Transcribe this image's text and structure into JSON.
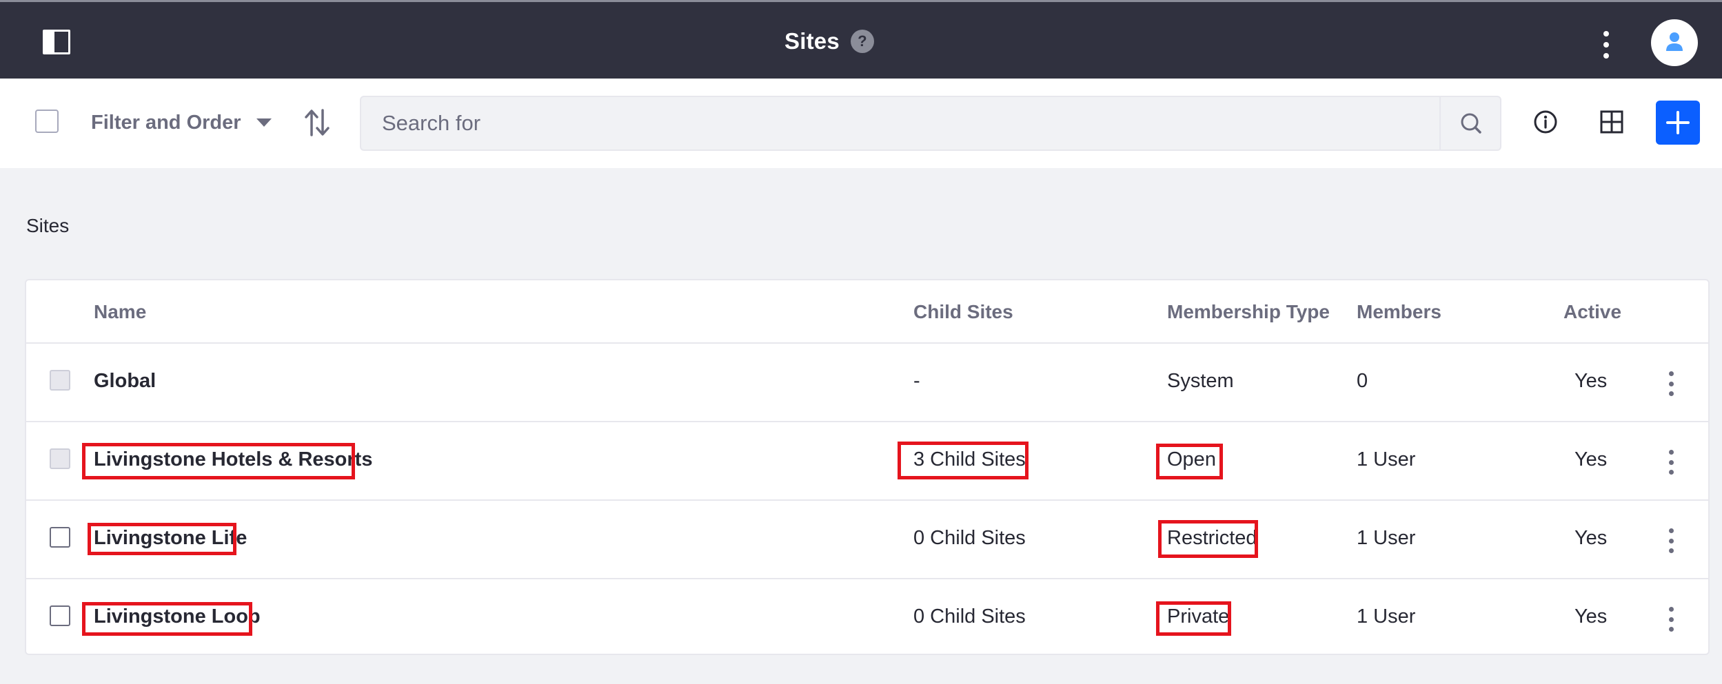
{
  "header": {
    "title": "Sites",
    "help_icon": "?",
    "icons": {
      "panel_toggle": "product-menu-icon",
      "options": "ellipsis-v-icon",
      "avatar": "user-icon"
    }
  },
  "toolbar": {
    "filter_label": "Filter and Order",
    "search_placeholder": "Search for",
    "icons": {
      "sort": "order-arrow-icon",
      "search": "search-icon",
      "info": "info-circle-icon",
      "view": "cards-view-icon",
      "add": "plus-icon"
    },
    "accent_color": "#0b5fff"
  },
  "breadcrumb": "Sites",
  "table": {
    "columns": [
      "Name",
      "Child Sites",
      "Membership Type",
      "Members",
      "Active"
    ],
    "rows": [
      {
        "name": "Global",
        "child_sites": "-",
        "membership_type": "System",
        "members": "0",
        "active": "Yes",
        "checkbox": "disabled"
      },
      {
        "name": "Livingstone Hotels & Resorts",
        "child_sites": "3 Child Sites",
        "membership_type": "Open",
        "members": "1 User",
        "active": "Yes",
        "checkbox": "disabled"
      },
      {
        "name": "Livingstone Life",
        "child_sites": "0 Child Sites",
        "membership_type": "Restricted",
        "members": "1 User",
        "active": "Yes",
        "checkbox": "enabled"
      },
      {
        "name": "Livingstone Loop",
        "child_sites": "0 Child Sites",
        "membership_type": "Private",
        "members": "1 User",
        "active": "Yes",
        "checkbox": "enabled"
      }
    ]
  },
  "highlight_color": "#e5141d"
}
